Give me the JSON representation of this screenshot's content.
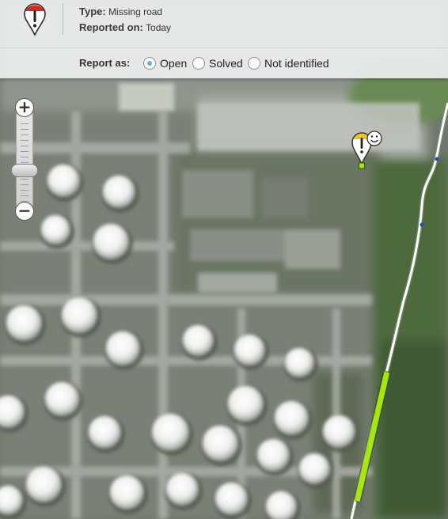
{
  "report": {
    "type_label": "Type:",
    "type_value": "Missing road",
    "reported_label": "Reported on:",
    "reported_value": "Today",
    "status_icon": "exclamation-pin-icon-red"
  },
  "report_as": {
    "label": "Report as:",
    "options": [
      {
        "label": "Open",
        "selected": true
      },
      {
        "label": "Solved",
        "selected": false
      },
      {
        "label": "Not identified",
        "selected": false
      }
    ]
  },
  "zoom": {
    "in_label": "+",
    "out_label": "−"
  },
  "map": {
    "imagery": "satellite",
    "marker_icon": "exclamation-pin-icon-yellow",
    "marker_badge_icon": "smiley-icon",
    "colors": {
      "road": "#ffffff",
      "missing_road": "#a6e800",
      "marker_head": "#f5c400",
      "radio_selected": "#63b3d8"
    }
  }
}
